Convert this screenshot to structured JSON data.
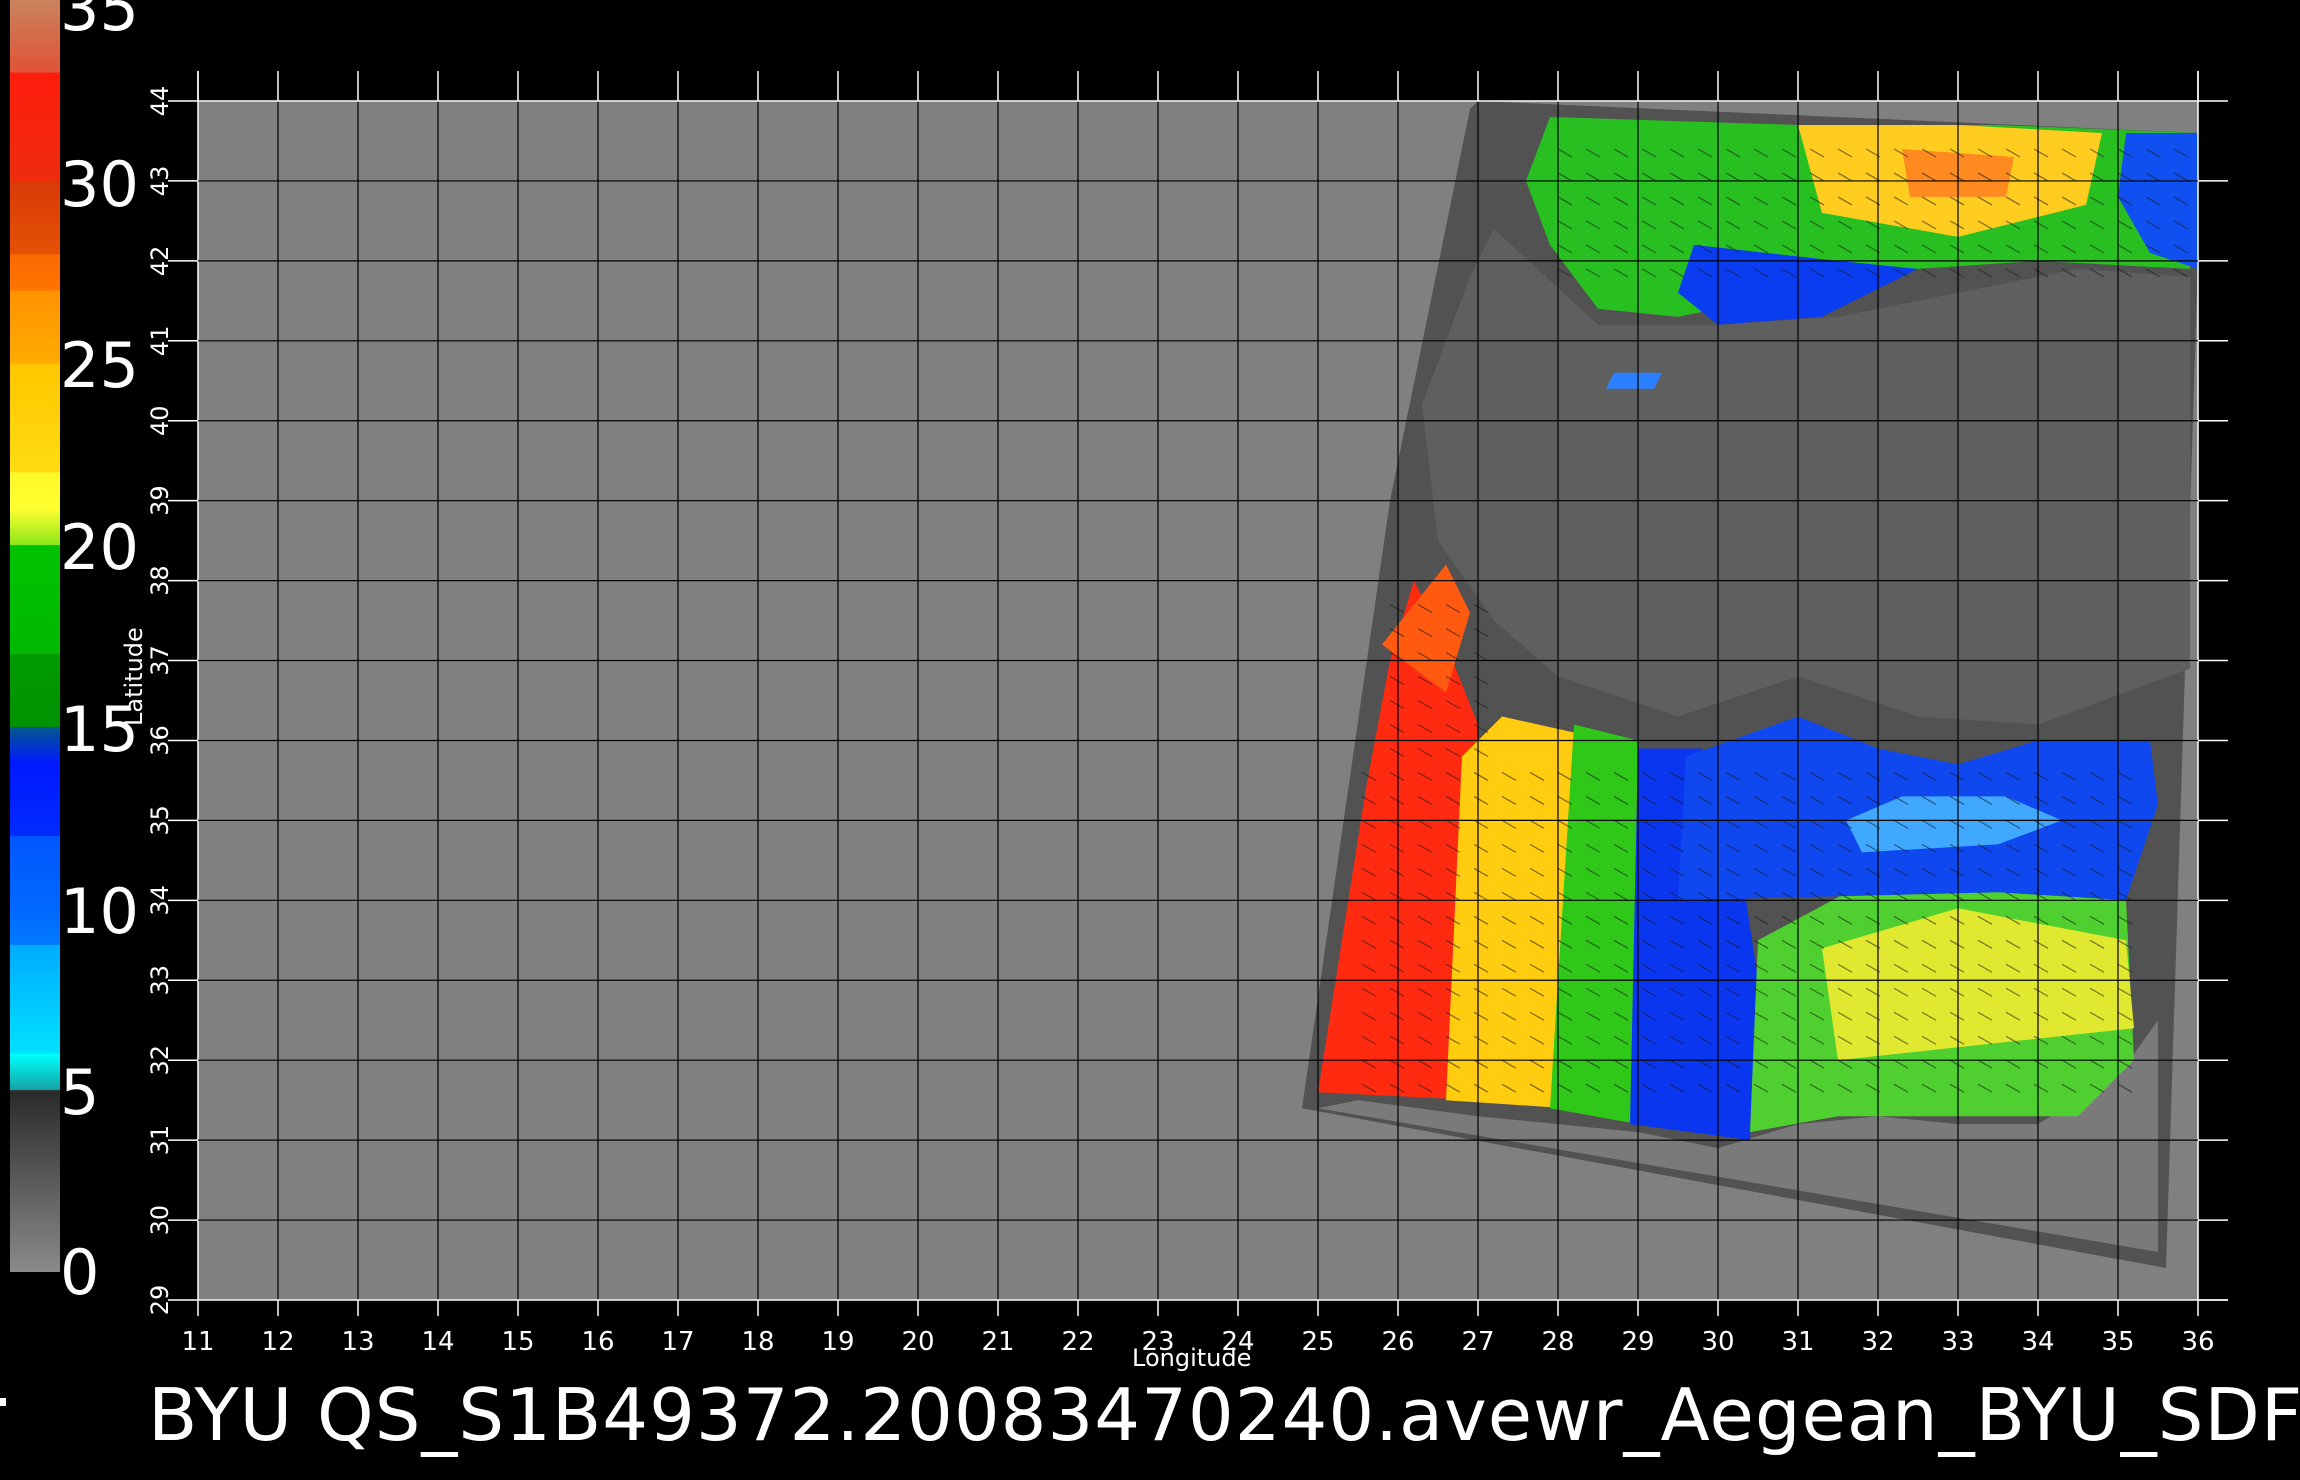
{
  "colorbar": {
    "tick_labels": [
      "35",
      "30",
      "25",
      "20",
      "15",
      "10",
      "5",
      "0"
    ],
    "stops": [
      {
        "value": 35,
        "color": "#c8845c"
      },
      {
        "value": 33,
        "color": "#ff1a0a"
      },
      {
        "value": 30,
        "color": "#d83a08"
      },
      {
        "value": 27,
        "color": "#ff8800"
      },
      {
        "value": 25,
        "color": "#ffc000"
      },
      {
        "value": 21,
        "color": "#ffff30"
      },
      {
        "value": 20,
        "color": "#00c800"
      },
      {
        "value": 15,
        "color": "#00a000"
      },
      {
        "value": 14,
        "color": "#0010ff"
      },
      {
        "value": 10,
        "color": "#0060ff"
      },
      {
        "value": 6,
        "color": "#00ffff"
      },
      {
        "value": 5,
        "color": "#303030"
      },
      {
        "value": 0,
        "color": "#808080"
      }
    ]
  },
  "map": {
    "x_axis_label": "Longitude",
    "y_axis_label": "Latitude",
    "lon_ticks": [
      "11",
      "12",
      "13",
      "14",
      "15",
      "16",
      "17",
      "18",
      "19",
      "20",
      "21",
      "22",
      "23",
      "24",
      "25",
      "26",
      "27",
      "28",
      "29",
      "30",
      "31",
      "32",
      "33",
      "34",
      "35",
      "36"
    ],
    "lat_ticks": [
      "29",
      "30",
      "31",
      "32",
      "33",
      "34",
      "35",
      "36",
      "37",
      "38",
      "39",
      "40",
      "41",
      "42",
      "43",
      "44"
    ],
    "background_color": "#808080",
    "land_color": "#5a5a5a",
    "grid_color": "#000000"
  },
  "caption": "BYU  QS_S1B49372.20083470240.avewr_Aegean_BYU_SDF",
  "chart_data": {
    "type": "heatmap",
    "title": "BYU  QS_S1B49372.20083470240.avewr_Aegean_BYU_SDF",
    "xlabel": "Longitude",
    "ylabel": "Latitude",
    "xlim": [
      11,
      36
    ],
    "ylim": [
      29,
      44
    ],
    "colorbar_range": [
      0,
      35
    ],
    "regions": [
      {
        "lon": [
          25,
          27
        ],
        "lat": [
          31.5,
          37
        ],
        "speed_range": [
          27,
          33
        ]
      },
      {
        "lon": [
          27,
          29
        ],
        "lat": [
          31.5,
          36
        ],
        "speed_range": [
          20,
          25
        ]
      },
      {
        "lon": [
          29,
          30.5
        ],
        "lat": [
          31,
          35
        ],
        "speed_range": [
          10,
          15
        ]
      },
      {
        "lon": [
          30.5,
          35.5
        ],
        "lat": [
          32,
          34
        ],
        "speed_range": [
          16,
          22
        ]
      },
      {
        "lon": [
          29.5,
          35
        ],
        "lat": [
          34,
          36
        ],
        "speed_range": [
          8,
          14
        ]
      },
      {
        "lon": [
          27.5,
          36
        ],
        "lat": [
          41.5,
          43.5
        ],
        "speed_range": [
          12,
          24
        ]
      }
    ]
  }
}
